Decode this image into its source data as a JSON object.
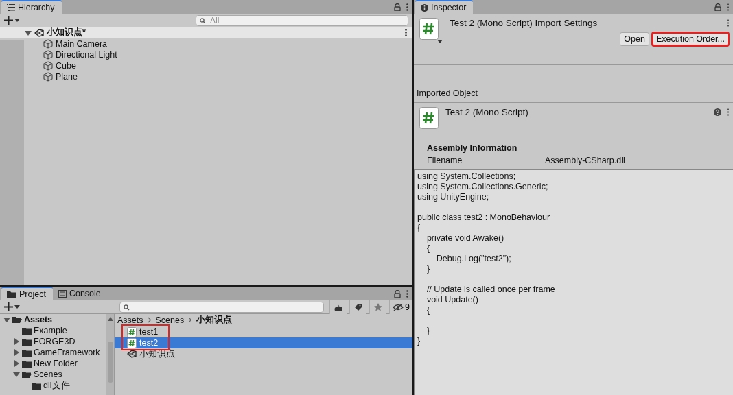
{
  "hierarchy": {
    "tab": "Hierarchy",
    "search": {
      "placeholder": "All"
    },
    "scene": {
      "name": "小知识点*",
      "expanded": true
    },
    "objects": [
      {
        "name": "Main Camera"
      },
      {
        "name": "Directional Light"
      },
      {
        "name": "Cube"
      },
      {
        "name": "Plane"
      }
    ]
  },
  "project": {
    "tabs": [
      {
        "label": "Project",
        "selected": true
      },
      {
        "label": "Console",
        "selected": false
      }
    ],
    "hidden_count": "9",
    "tree": [
      {
        "name": "Assets",
        "expanded": true,
        "children": [
          {
            "name": "Example"
          },
          {
            "name": "FORGE3D",
            "expanded": false
          },
          {
            "name": "GameFramework",
            "expanded": false
          },
          {
            "name": "New Folder",
            "expanded": false
          },
          {
            "name": "Scenes",
            "expanded": true,
            "children": [
              {
                "name": "dll文件"
              }
            ]
          }
        ]
      }
    ],
    "breadcrumb": [
      "Assets",
      "Scenes",
      "小知识点"
    ],
    "files": [
      {
        "name": "test1",
        "kind": "script",
        "selected": false,
        "highlighted": true
      },
      {
        "name": "test2",
        "kind": "script",
        "selected": true,
        "highlighted": true
      },
      {
        "name": "小知识点",
        "kind": "scene",
        "selected": false,
        "highlighted": false
      }
    ]
  },
  "inspector": {
    "tab": "Inspector",
    "title": "Test 2 (Mono Script) Import Settings",
    "buttons": [
      {
        "label": "Open",
        "highlighted": false
      },
      {
        "label": "Execution Order...",
        "highlighted": true
      }
    ],
    "section": "Imported Object",
    "object_title": "Test 2 (Mono Script)",
    "assembly": {
      "heading": "Assembly Information",
      "label": "Filename",
      "value": "Assembly-CSharp.dll"
    },
    "code": "using System.Collections;\nusing System.Collections.Generic;\nusing UnityEngine;\n\npublic class test2 : MonoBehaviour\n{\n    private void Awake()\n    {\n        Debug.Log(\"test2\");\n    }\n\n    // Update is called once per frame\n    void Update()\n    {\n\n    }\n}"
  }
}
